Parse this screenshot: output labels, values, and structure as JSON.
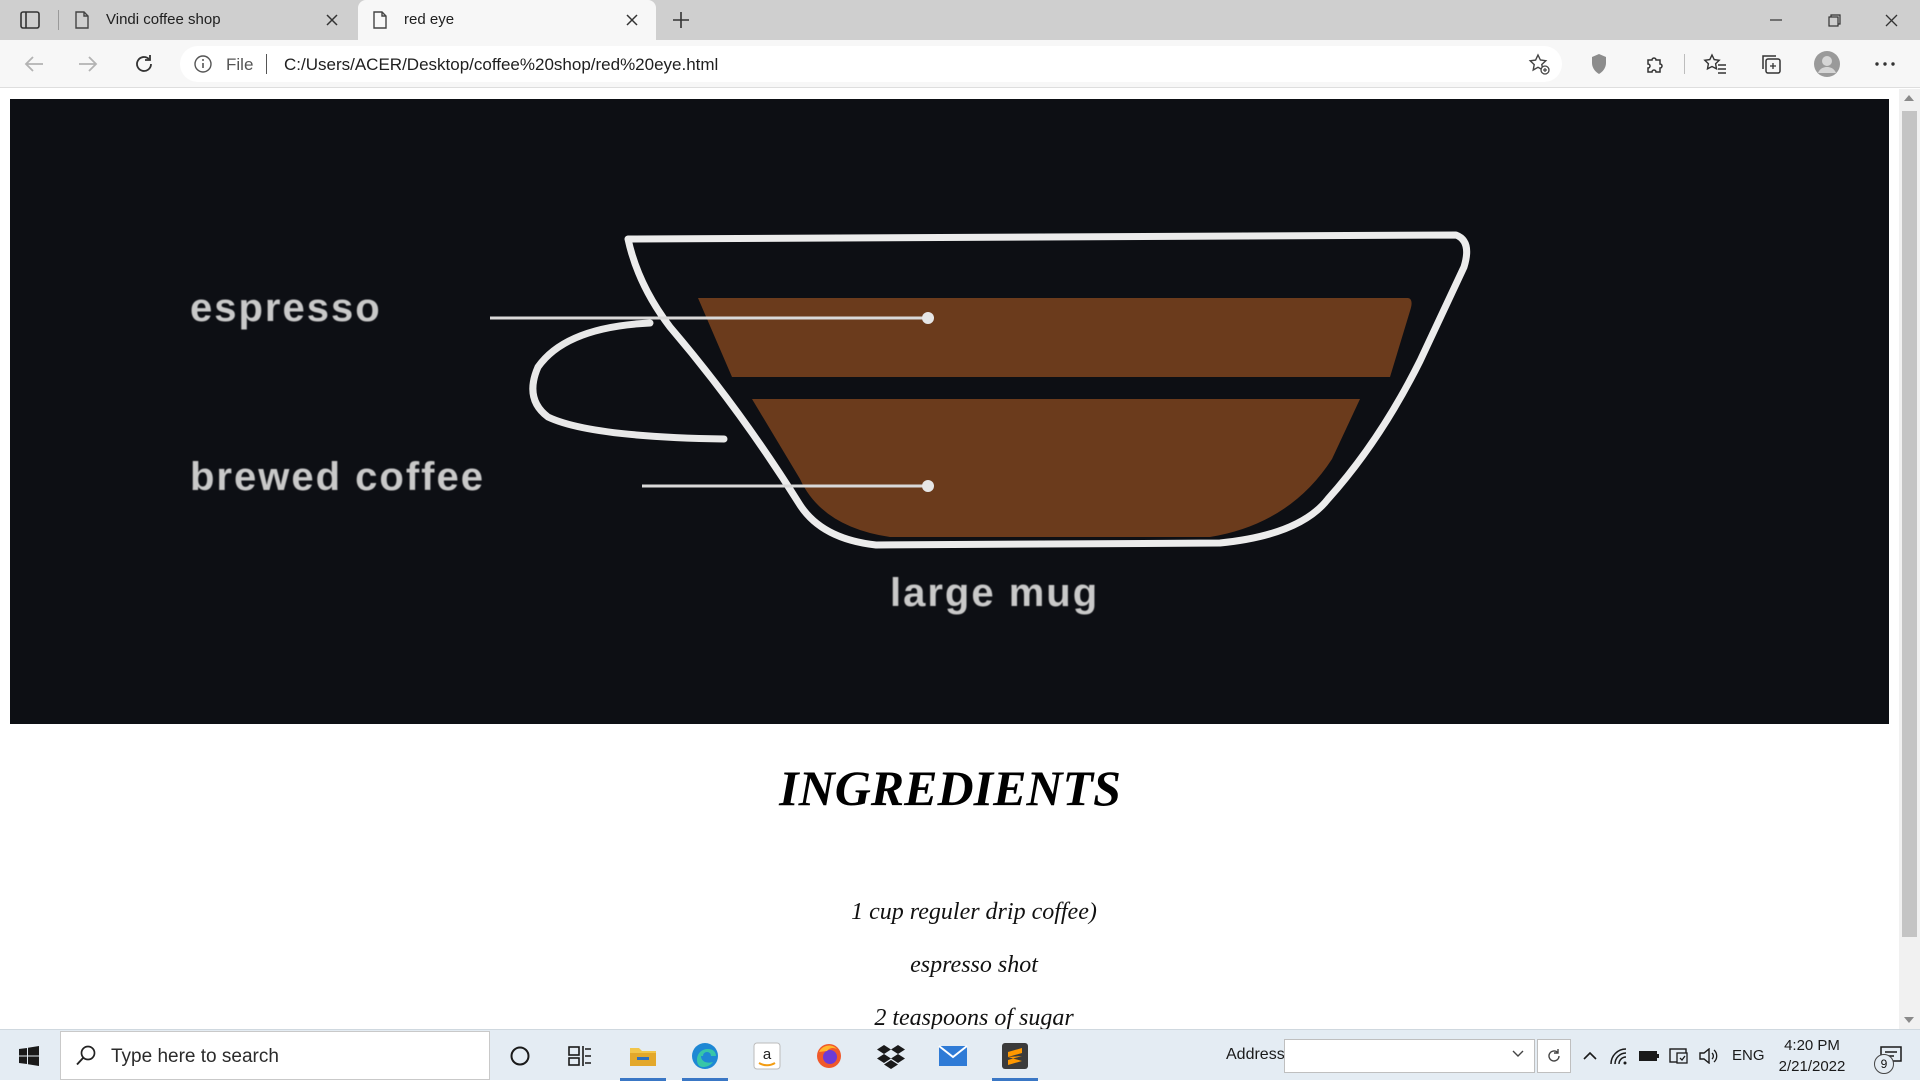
{
  "browser": {
    "tabs": [
      {
        "title": "Vindi coffee shop",
        "active": false
      },
      {
        "title": "red eye",
        "active": true
      }
    ],
    "address": {
      "scheme_label": "File",
      "url": "C:/Users/ACER/Desktop/coffee%20shop/red%20eye.html"
    }
  },
  "page": {
    "hero_image": {
      "labels": {
        "espresso": "espresso",
        "brewed": "brewed coffee",
        "mug": "large mug"
      },
      "colors": {
        "background": "#0d0f14",
        "coffee": "#6b3b1c",
        "cup_outline": "#ececec"
      }
    },
    "ingredients_title": "INGREDIENTS",
    "ingredients": [
      "1 cup reguler drip coffee)",
      "espresso shot",
      "2 teaspoons of sugar"
    ]
  },
  "taskbar": {
    "search_placeholder": "Type here to search",
    "address_label": "Address",
    "language": "ENG",
    "time": "4:20 PM",
    "date": "2/21/2022",
    "notification_count": "9",
    "apps": [
      "cortana-icon",
      "task-view-icon",
      "file-explorer-icon",
      "edge-icon",
      "amazon-icon",
      "firefox-icon",
      "dropbox-icon",
      "mail-icon",
      "sublime-text-icon"
    ]
  }
}
